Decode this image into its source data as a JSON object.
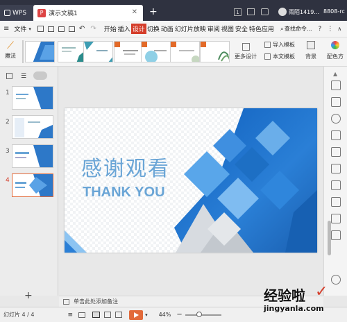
{
  "titlebar": {
    "app_tab": "WPS",
    "doc_tab": "演示文稿1",
    "page_num": "1",
    "user": "雨陌1419...",
    "extra": "8808-rc"
  },
  "menu": {
    "file": "文件",
    "items": [
      "开始",
      "插入",
      "设计",
      "切换",
      "动画",
      "幻灯片放映",
      "审阅",
      "视图",
      "安全",
      "特色应用"
    ],
    "active": "设计",
    "search": "查找命令..."
  },
  "ribbon": {
    "magic": "魔法",
    "more_designs": "更多设计",
    "import_template": "导入模板",
    "local_template": "本文模板",
    "background": "背景",
    "color_scheme": "配色方"
  },
  "slides": [
    {
      "num": "1"
    },
    {
      "num": "2"
    },
    {
      "num": "3"
    },
    {
      "num": "4"
    }
  ],
  "slide": {
    "title": "感谢观看",
    "subtitle": "THANK YOU"
  },
  "notes": {
    "placeholder": "单击此处添加备注"
  },
  "status": {
    "slide_count": "幻灯片 4 / 4",
    "zoom": "44%"
  },
  "watermark": {
    "text": "经验啦",
    "url": "jingyanla.com"
  },
  "colors": {
    "accent": "#d43d2a",
    "slide_blue": "#1d6fc4",
    "slide_text": "#6aa5d6",
    "title_dark": "#2f3240"
  }
}
